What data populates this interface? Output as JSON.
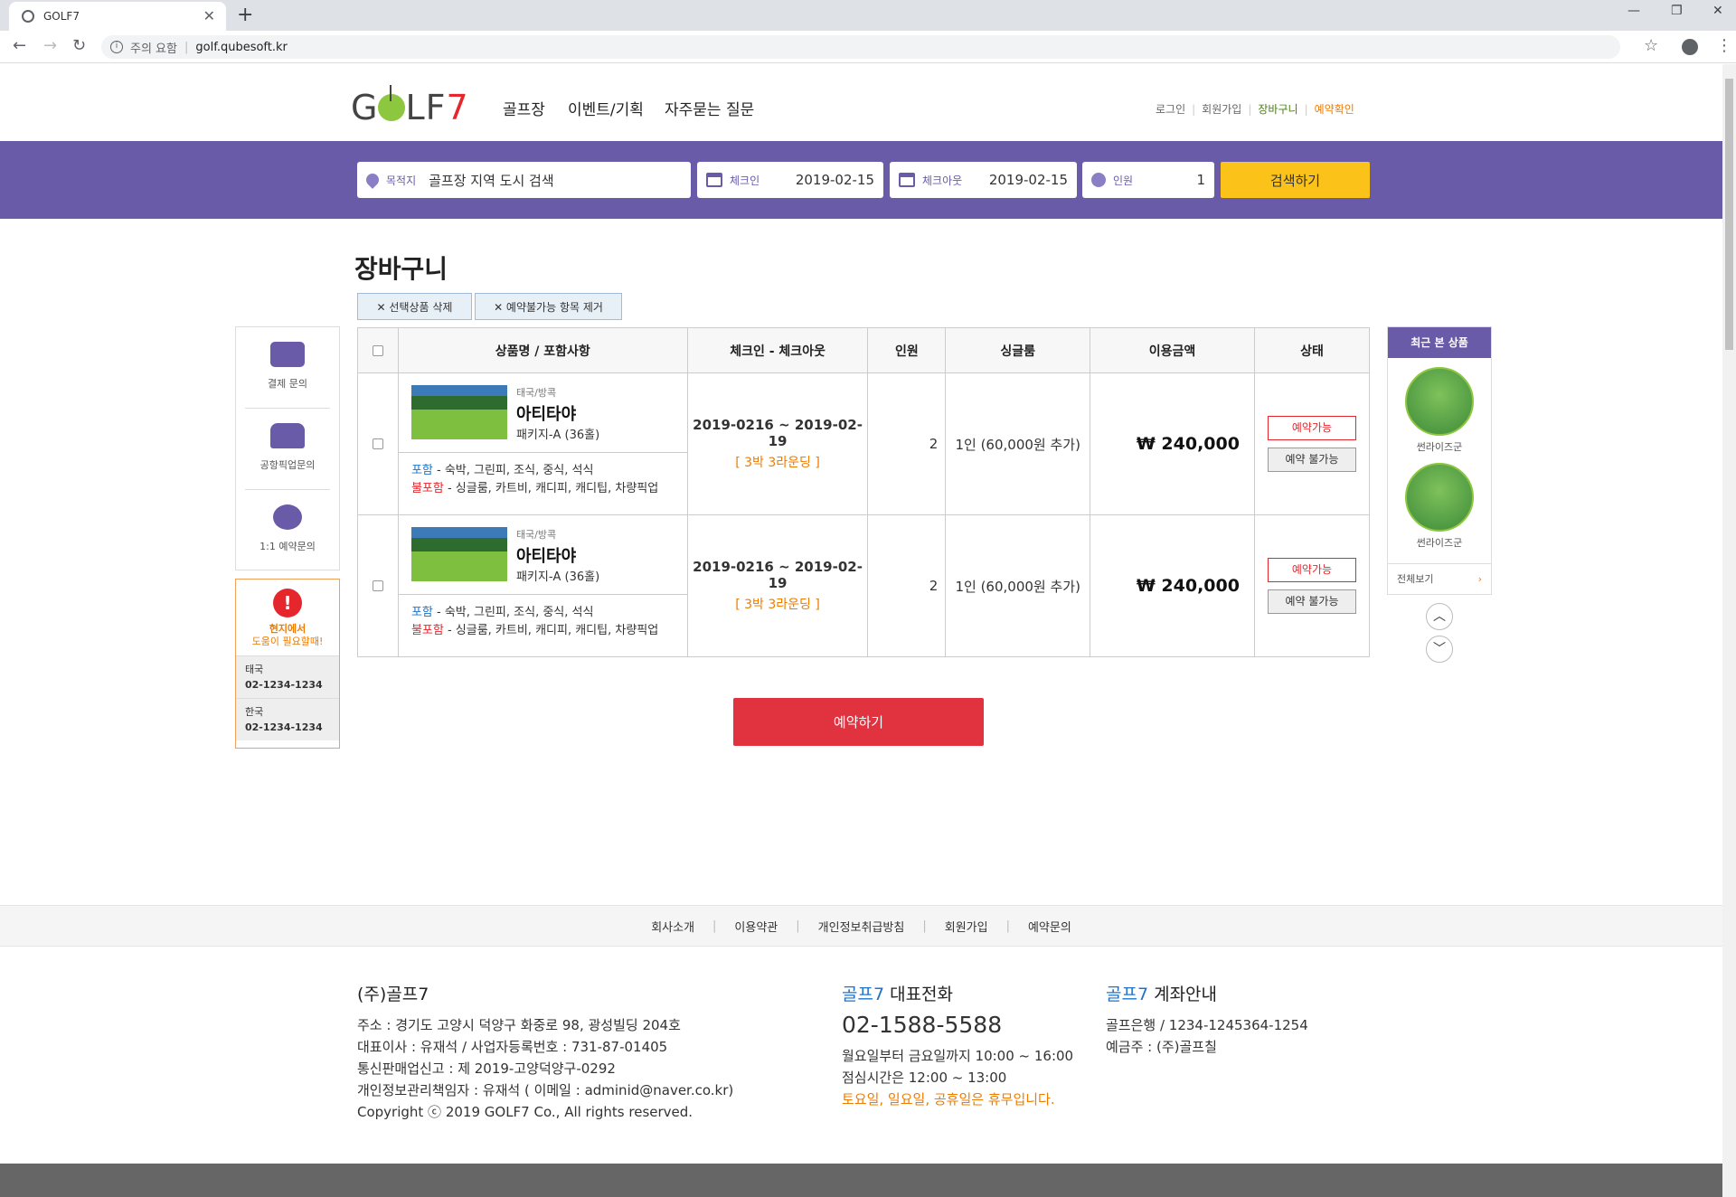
{
  "browser": {
    "tab_title": "GOLF7",
    "tab_close": "✕",
    "new_tab": "+",
    "security_label": "주의 요함",
    "url": "golf.qubesoft.kr"
  },
  "header": {
    "logo_g": "G",
    "logo_text": "LF",
    "logo_seven": "7",
    "nav": [
      "골프장",
      "이벤트/기획",
      "자주묻는 질문"
    ],
    "util": {
      "login": "로그인",
      "signup": "회원가입",
      "cart": "장바구니",
      "reservation": "예약확인"
    }
  },
  "search": {
    "destination_label": "목적지",
    "destination_value": "골프장 지역 도시 검색",
    "checkin_label": "체크인",
    "checkin_value": "2019-02-15",
    "checkout_label": "체크아웃",
    "checkout_value": "2019-02-15",
    "guests_label": "인원",
    "guests_value": "1",
    "button": "검색하기"
  },
  "cart": {
    "title": "장바구니",
    "delete_selected": "✕ 선택상품 삭제",
    "remove_unavailable": "✕ 예약불가능 항목 제거",
    "columns": [
      "상품명 / 포함사항",
      "체크인 - 체크아웃",
      "인원",
      "싱글룸",
      "이용금액",
      "상태"
    ],
    "items": [
      {
        "region": "태국/방콕",
        "name": "아티타야",
        "package": "패키지-A (36홀)",
        "include_label": "포함",
        "include_text": " - 숙박, 그린피, 조식, 중식, 석식",
        "exclude_label": "불포함",
        "exclude_text": " - 싱글룸, 카트비, 캐디피, 캐디팁, 차량픽업",
        "dates": "2019-0216 ~ 2019-02-19",
        "nights": "[ 3박 3라운딩 ]",
        "guests": "2",
        "single_room": "1인 (60,000원 추가)",
        "price": "₩ 240,000",
        "status_available": "예약가능",
        "status_unavailable": "예약 불가능"
      },
      {
        "region": "태국/방콕",
        "name": "아티타야",
        "package": "패키지-A (36홀)",
        "include_label": "포함",
        "include_text": " - 숙박, 그린피, 조식, 중식, 석식",
        "exclude_label": "불포함",
        "exclude_text": " - 싱글룸, 카트비, 캐디피, 캐디팁, 차량픽업",
        "dates": "2019-0216 ~ 2019-02-19",
        "nights": "[ 3박 3라운딩 ]",
        "guests": "2",
        "single_room": "1인 (60,000원 추가)",
        "price": "₩ 240,000",
        "status_available": "예약가능",
        "status_unavailable": "예약 불가능"
      }
    ],
    "reserve_button": "예약하기"
  },
  "quick_menu": {
    "payment": "결제 문의",
    "airport": "공항픽업문의",
    "inquiry": "1:1 예약문의",
    "help_icon": "!",
    "help_title": "현지에서",
    "help_sub": "도움이 필요할때!",
    "thai_label": "태국",
    "thai_phone": "02-1234-1234",
    "korea_label": "한국",
    "korea_phone": "02-1234-1234"
  },
  "recent": {
    "title": "최근 본 상품",
    "items": [
      "썬라이즈군",
      "썬라이즈군"
    ],
    "view_all": "전체보기",
    "view_all_arrow": "›",
    "up": "︿",
    "down": "﹀"
  },
  "footer": {
    "links": [
      "회사소개",
      "이용약관",
      "개인정보취급방침",
      "회원가입",
      "예약문의"
    ],
    "company": "(주)골프7",
    "address": "주소 : 경기도 고양시 덕양구 화중로 98, 광성빌딩 204호",
    "ceo": "대표이사 : 유재석  /  사업자등록번호 : 731-87-01405",
    "ecommerce": "통신판매업신고 : 제 2019-고양덕양구-0292",
    "privacy_officer": "개인정보관리책임자 : 유재석 ( 이메일 : adminid@naver.co.kr)",
    "copyright": "Copyright ⓒ 2019 GOLF7 Co., All rights reserved.",
    "tel_brand": "골프7",
    "tel_title": " 대표전화",
    "tel": "02-1588-5588",
    "hours": "월요일부터 금요일까지 10:00 ~ 16:00",
    "lunch": "점심시간은 12:00 ~ 13:00",
    "holiday": "토요일, 일요일, 공휴일은 휴무입니다.",
    "bank_brand": "골프7",
    "bank_title": " 계좌안내",
    "bank_account": "골프은행  /  1234-1245364-1254",
    "bank_holder": "예금주 : (주)골프칠"
  }
}
